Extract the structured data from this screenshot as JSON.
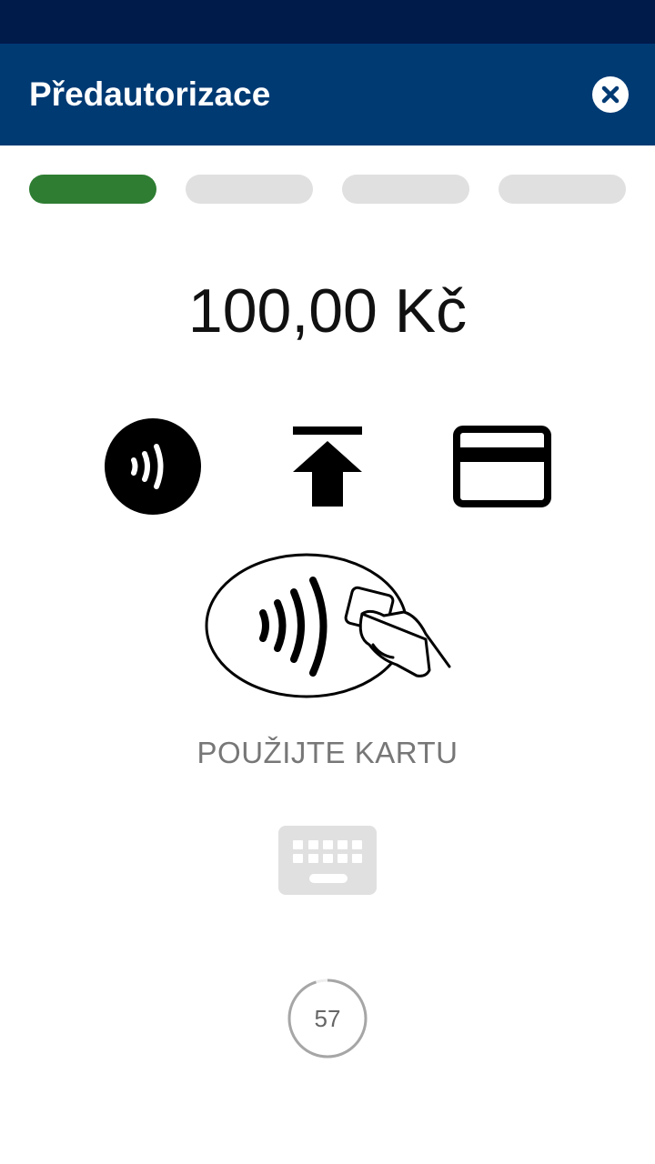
{
  "header": {
    "title": "Předautorizace",
    "close_icon": "close-icon"
  },
  "steps": {
    "total": 4,
    "current": 1,
    "active_color": "#2e7d32",
    "inactive_color": "#e0e0e0"
  },
  "amount": "100,00 Kč",
  "methods": {
    "icons": [
      "contactless-icon",
      "insert-card-icon",
      "swipe-card-icon"
    ]
  },
  "instruction": "POUŽIJTE KARTU",
  "keyboard": {
    "icon": "keyboard-icon"
  },
  "timer": {
    "value": "57",
    "progress": 0.95
  },
  "colors": {
    "status_bar": "#001a4a",
    "app_bar": "#003a73"
  }
}
